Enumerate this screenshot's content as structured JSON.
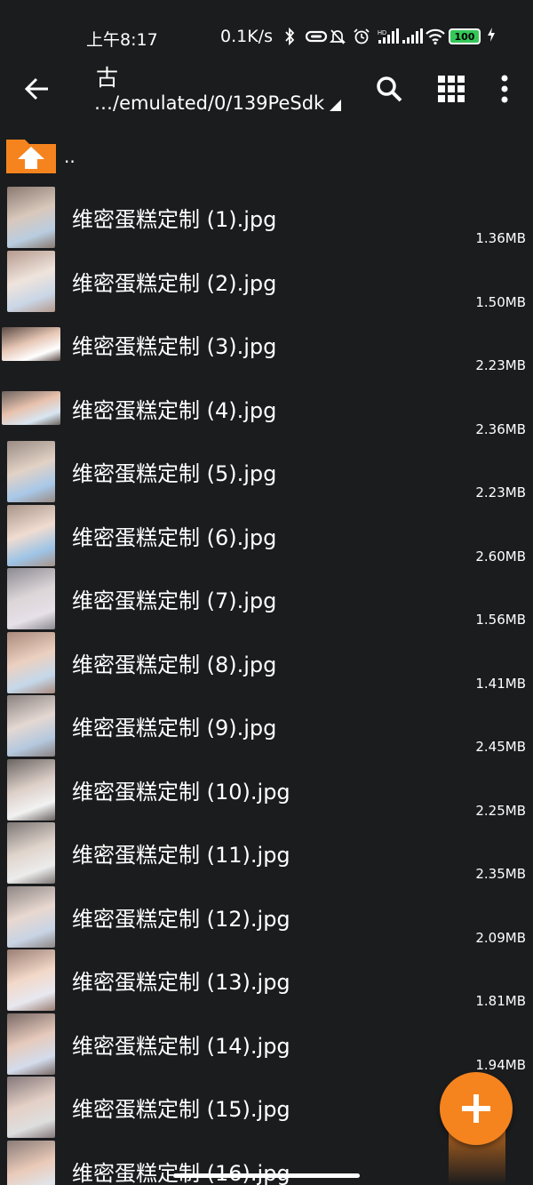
{
  "status_bar": {
    "time": "上午8:17",
    "net_speed": "0.1K/s",
    "battery": "100",
    "icons": [
      "bluetooth-icon",
      "link-icon",
      "mute-icon",
      "alarm-icon",
      "hd-signal-icon",
      "signal-icon",
      "wifi-icon",
      "battery-icon",
      "charging-icon"
    ]
  },
  "toolbar": {
    "title": "古",
    "path": "…/emulated/0/139PeSdk",
    "icons": [
      "back-arrow-icon",
      "search-icon",
      "grid-view-icon",
      "more-vert-icon"
    ]
  },
  "parent": {
    "label": ".."
  },
  "files": [
    {
      "name": "维密蛋糕定制 (1).jpg",
      "size": "1.36MB"
    },
    {
      "name": "维密蛋糕定制 (2).jpg",
      "size": "1.50MB"
    },
    {
      "name": "维密蛋糕定制 (3).jpg",
      "size": "2.23MB"
    },
    {
      "name": "维密蛋糕定制 (4).jpg",
      "size": "2.36MB"
    },
    {
      "name": "维密蛋糕定制 (5).jpg",
      "size": "2.23MB"
    },
    {
      "name": "维密蛋糕定制 (6).jpg",
      "size": "2.60MB"
    },
    {
      "name": "维密蛋糕定制 (7).jpg",
      "size": "1.56MB"
    },
    {
      "name": "维密蛋糕定制 (8).jpg",
      "size": "1.41MB"
    },
    {
      "name": "维密蛋糕定制 (9).jpg",
      "size": "2.45MB"
    },
    {
      "name": "维密蛋糕定制 (10).jpg",
      "size": "2.25MB"
    },
    {
      "name": "维密蛋糕定制 (11).jpg",
      "size": "2.35MB"
    },
    {
      "name": "维密蛋糕定制 (12).jpg",
      "size": "2.09MB"
    },
    {
      "name": "维密蛋糕定制 (13).jpg",
      "size": "1.81MB"
    },
    {
      "name": "维密蛋糕定制 (14).jpg",
      "size": "1.94MB"
    },
    {
      "name": "维密蛋糕定制 (15).jpg",
      "size": ""
    },
    {
      "name": "维密蛋糕定制 (16).jpg",
      "size": ""
    }
  ],
  "fab": {
    "icon": "plus-icon"
  },
  "colors": {
    "background": "#1b1c1e",
    "accent": "#f5841f",
    "battery": "#34c759"
  }
}
